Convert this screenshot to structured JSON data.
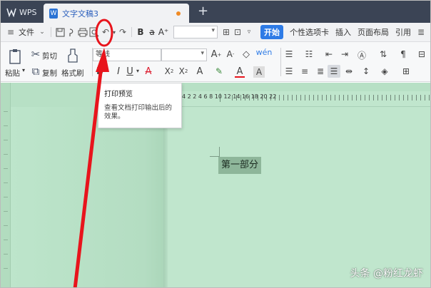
{
  "titlebar": {
    "app_label": "WPS",
    "doc_tab_label": "文字文稿3",
    "new_tab_symbol": "+"
  },
  "menubar": {
    "file_label": "文件",
    "tabs": [
      {
        "label": "开始",
        "active": true
      },
      {
        "label": "个性选项卡",
        "active": false
      },
      {
        "label": "插入",
        "active": false
      },
      {
        "label": "页面布局",
        "active": false
      },
      {
        "label": "引用",
        "active": false
      }
    ]
  },
  "toolbar": {
    "cut_label": "剪切",
    "paste_label": "粘贴",
    "copy_label": "复制",
    "format_painter_label": "格式刷",
    "font_value": "等线"
  },
  "tooltip": {
    "title": "打印预览",
    "description": "查看文档打印输出后的效果。"
  },
  "ruler": {
    "numbers": "4   2   2   4   6   8   10  12  14  16  18  20  22"
  },
  "document": {
    "heading": "第一部分"
  },
  "watermark": {
    "text": "头条 @粉红龙虾"
  },
  "colors": {
    "titlebar_bg": "#3b4455",
    "accent_blue": "#2e7be6",
    "workspace_green": "#b7e0c5",
    "annotation_red": "#e8141c"
  }
}
